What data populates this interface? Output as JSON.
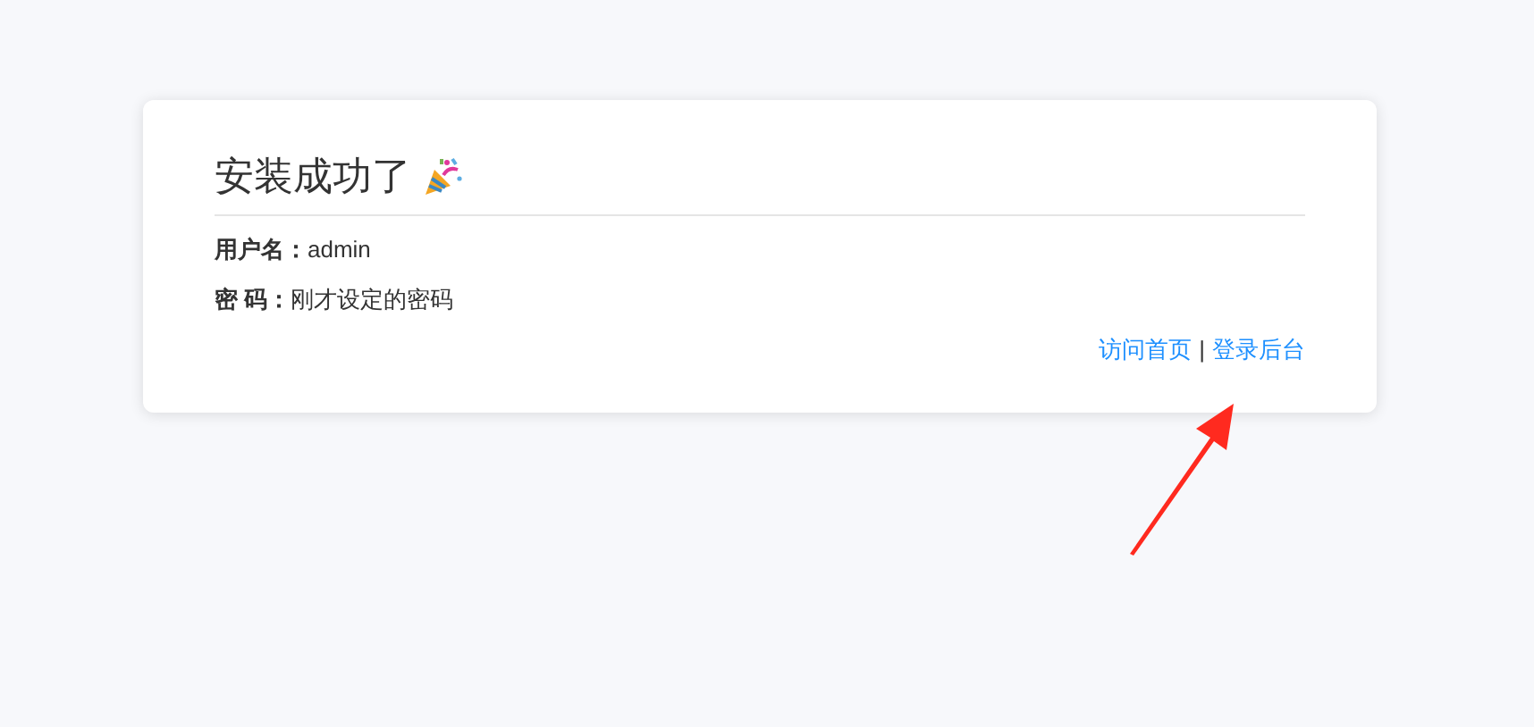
{
  "card": {
    "title": "安装成功了",
    "fields": [
      {
        "label": "用户名：",
        "value": "admin"
      },
      {
        "label": "密 码：",
        "value": "刚才设定的密码"
      }
    ],
    "links": [
      "访问首页",
      "登录后台"
    ],
    "separator": "|"
  }
}
